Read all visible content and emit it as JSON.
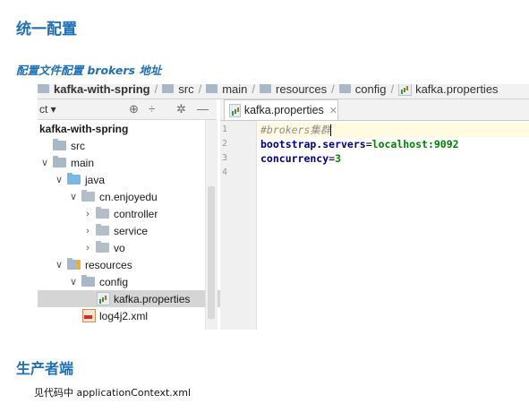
{
  "doc": {
    "title": "统一配置",
    "subtitle": "配置文件配置 brokers 地址",
    "section2_title": "生产者端",
    "section2_text": "见代码中 applicationContext.xml"
  },
  "ide": {
    "breadcrumb": [
      "kafka-with-spring",
      "src",
      "main",
      "resources",
      "config",
      "kafka.properties"
    ],
    "project_view_label": "ct ▾",
    "toolbar_icons": [
      "locate-icon",
      "collapse-icon",
      "settings-icon",
      "hide-icon"
    ],
    "tree": [
      {
        "label": "kafka-with-spring",
        "indent": 0,
        "arrow": "",
        "icon": "none",
        "bold": true
      },
      {
        "label": "src",
        "indent": 0,
        "arrow": "",
        "icon": "folder"
      },
      {
        "label": "main",
        "indent": 0,
        "arrow": "∨",
        "icon": "folder"
      },
      {
        "label": "java",
        "indent": 1,
        "arrow": "∨",
        "icon": "src-folder"
      },
      {
        "label": "cn.enjoyedu",
        "indent": 2,
        "arrow": "∨",
        "icon": "package"
      },
      {
        "label": "controller",
        "indent": 3,
        "arrow": "›",
        "icon": "package"
      },
      {
        "label": "service",
        "indent": 3,
        "arrow": "›",
        "icon": "package"
      },
      {
        "label": "vo",
        "indent": 3,
        "arrow": "›",
        "icon": "package"
      },
      {
        "label": "resources",
        "indent": 1,
        "arrow": "∨",
        "icon": "res-folder"
      },
      {
        "label": "config",
        "indent": 2,
        "arrow": "∨",
        "icon": "folder"
      },
      {
        "label": "kafka.properties",
        "indent": 4,
        "arrow": "",
        "icon": "properties",
        "selected": true
      },
      {
        "label": "log4j2.xml",
        "indent": 3,
        "arrow": "",
        "icon": "xml"
      }
    ],
    "tab_label": "kafka.properties",
    "line_numbers": [
      "1",
      "2",
      "3",
      "4"
    ],
    "code": {
      "line1": "#brokers集群",
      "line2_key": "bootstrap.servers",
      "line2_val": "localhost:9092",
      "line3_key": "concurrency",
      "line3_val": "3",
      "eq": "="
    }
  }
}
